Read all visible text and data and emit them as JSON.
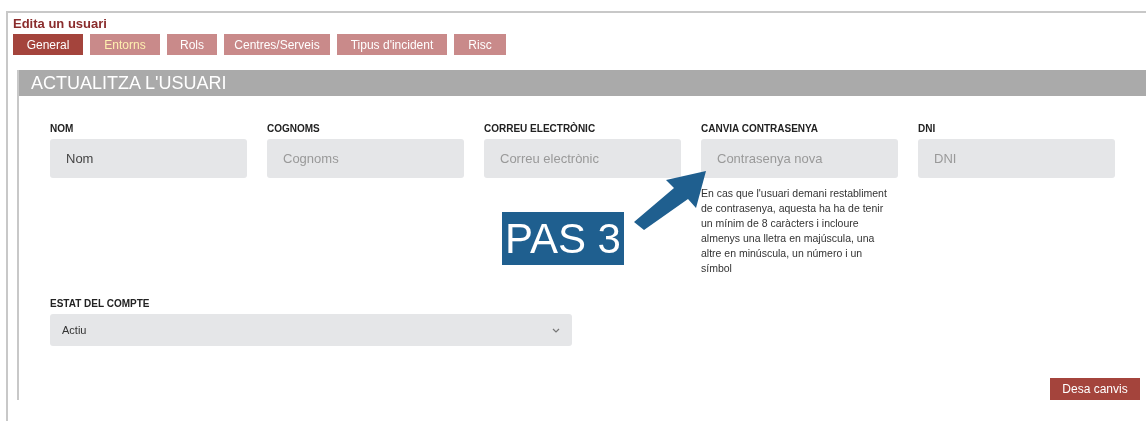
{
  "page_title": "Edita un usuari",
  "tabs": [
    {
      "label": "General",
      "selected": true,
      "hovered": false
    },
    {
      "label": "Entorns",
      "selected": false,
      "hovered": true
    },
    {
      "label": "Rols",
      "selected": false,
      "hovered": false
    },
    {
      "label": "Centres/Serveis",
      "selected": false,
      "hovered": false
    },
    {
      "label": "Tipus d'incident",
      "selected": false,
      "hovered": false
    },
    {
      "label": "Risc",
      "selected": false,
      "hovered": false
    }
  ],
  "section_title": "ACTUALITZA L'USUARI",
  "fields": [
    {
      "label": "NOM",
      "value": "Nom"
    },
    {
      "label": "COGNOMS",
      "placeholder": "Cognoms"
    },
    {
      "label": "CORREU ELECTRÒNIC",
      "placeholder": "Correu electrònic"
    },
    {
      "label": "CANVIA CONTRASENYA",
      "placeholder": "Contrasenya nova",
      "help": "En cas que l'usuari demani restabliment de contrasenya, aquesta ha ha de tenir un mínim de 8 caràcters i incloure almenys una lletra en majúscula, una altre en minúscula, un número i un símbol"
    },
    {
      "label": "DNI",
      "placeholder": "DNI"
    }
  ],
  "account_status": {
    "label": "ESTAT DEL COMPTE",
    "value": "Actiu"
  },
  "annotation": {
    "label": "PAS 3"
  },
  "save_button": "Desa canvis"
}
